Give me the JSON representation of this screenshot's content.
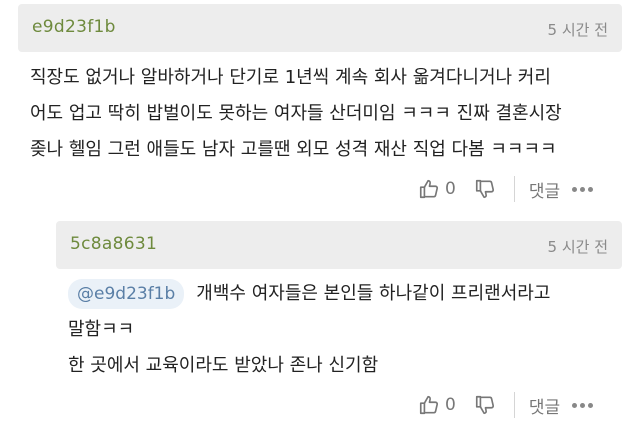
{
  "comments": [
    {
      "username": "e9d23f1b",
      "time": "5 시간 전",
      "lines": [
        "직장도 없거나 알바하거나 단기로 1년씩 계속 회사 옮겨다니거나 커리",
        "어도 업고 딱히 밥벌이도 못하는 여자들 산더미임 ㅋㅋㅋ 진짜 결혼시장",
        "좆나 헬임 그런 애들도 남자 고를땐 외모 성격 재산 직업 다봄 ㅋㅋㅋㅋ"
      ],
      "like_count": "0",
      "reply_label": "댓글"
    },
    {
      "username": "5c8a8631",
      "time": "5 시간 전",
      "mention": "@e9d23f1b",
      "lines": [
        "개백수 여자들은 본인들 하나같이 프리랜서라고",
        "말함ㅋㅋ",
        "한 곳에서 교육이라도 받았나 존나 신기함"
      ],
      "like_count": "0",
      "reply_label": "댓글"
    }
  ]
}
